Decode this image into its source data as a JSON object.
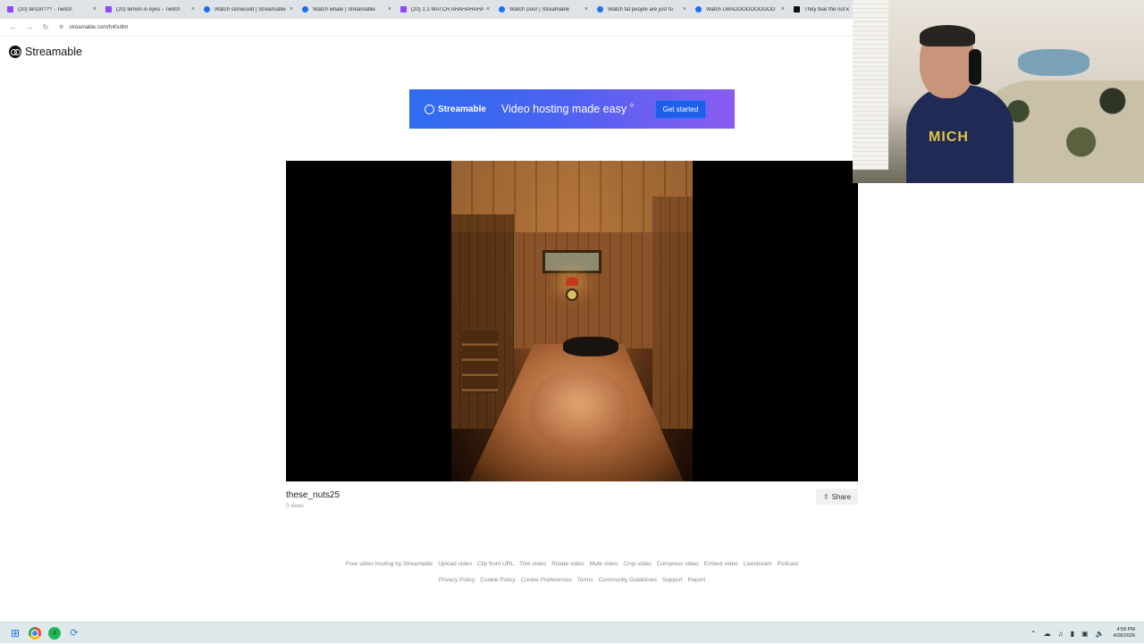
{
  "browser": {
    "tabs": [
      {
        "title": "(20) tenzin??? - Twitch",
        "icon": "twitch-icon"
      },
      {
        "title": "(20) lemon in eyes - Twitch",
        "icon": "twitch-icon"
      },
      {
        "title": "Watch stonecold | Streamable",
        "icon": "streamable-icon"
      },
      {
        "title": "Watch whale | Streamable",
        "icon": "streamable-icon"
      },
      {
        "title": "(20) 1:1 MATCH AHAHAHAHA",
        "icon": "twitch-icon"
      },
      {
        "title": "Watch Door | Streamable",
        "icon": "streamable-icon"
      },
      {
        "title": "Watch fat people are just fu",
        "icon": "streamable-icon"
      },
      {
        "title": "Watch LMAOOOOOOOOOO",
        "icon": "streamable-icon"
      },
      {
        "title": "They fear the nut k",
        "icon": "tiktok-icon"
      }
    ],
    "url": "streamable.com/h40u9m"
  },
  "site": {
    "logo_text": "Streamable"
  },
  "banner": {
    "brand": "Streamable",
    "headline": "Video hosting made easy",
    "cta": "Get started"
  },
  "video": {
    "title": "these_nuts25",
    "views": "0 views",
    "share_label": "Share"
  },
  "footer": {
    "row1": [
      "Free video hosting by Streamable",
      "Upload video",
      "Clip from URL",
      "Trim video",
      "Rotate video",
      "Mute video",
      "Crop video",
      "Compress video",
      "Embed video",
      "Livestream",
      "Podcast"
    ],
    "row2": [
      "Privacy Policy",
      "Cookie Policy",
      "Cookie Preferences",
      "Terms",
      "Community Guidelines",
      "Support",
      "Report"
    ]
  },
  "webcam": {
    "shirt_text": "MICH"
  },
  "taskbar": {
    "time": "4:59 PM",
    "date": "4/28/2026"
  }
}
